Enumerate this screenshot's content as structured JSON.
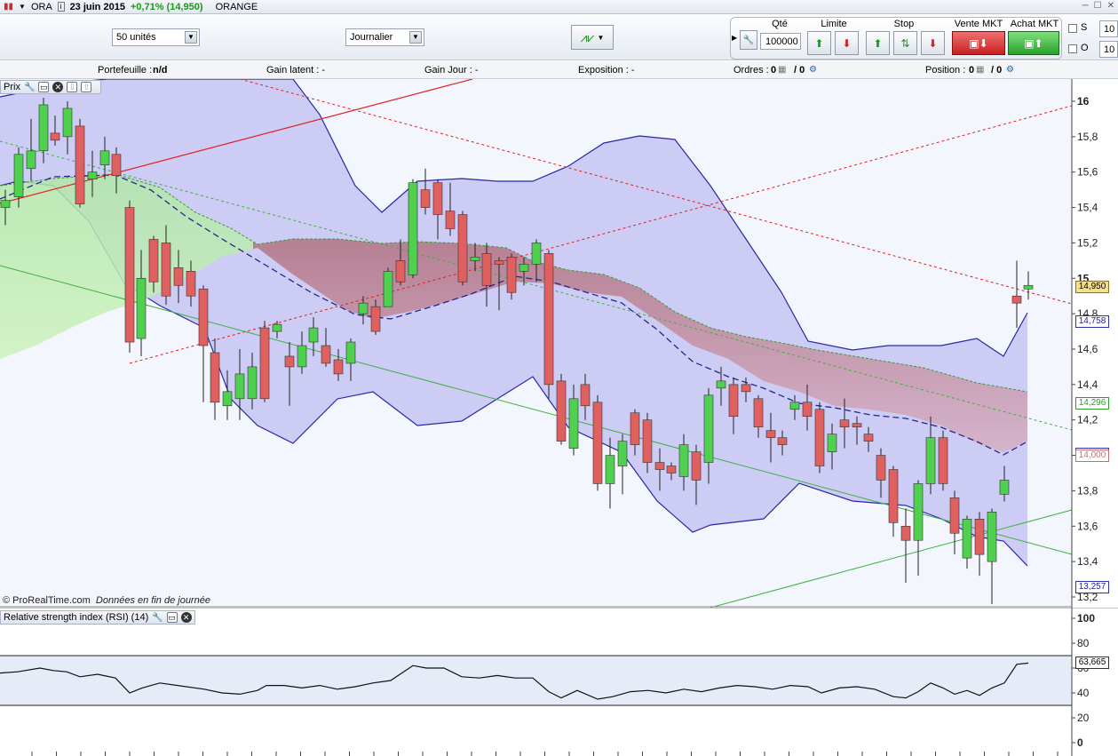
{
  "title": {
    "ticker": "ORA",
    "date": "23 juin 2015",
    "change": "+0,71% (14,950)",
    "name": "ORANGE"
  },
  "toolbar": {
    "quantity_select": "50 unités",
    "period_select": "Journalier",
    "qty_label": "Qté",
    "qty_value": "100000",
    "limit_label": "Limite",
    "stop_label": "Stop",
    "sell_label": "Vente MKT",
    "buy_label": "Achat MKT",
    "s_label": "S",
    "o_label": "O",
    "s_value": "10",
    "o_value": "10"
  },
  "infobar": {
    "portfolio_label": "Portefeuille :",
    "portfolio_value": "n/d",
    "gain_latent": "Gain latent :  -",
    "gain_jour": "Gain Jour :  -",
    "exposition": "Exposition :  -",
    "ordres_label": "Ordres :",
    "ordres_a": "0",
    "ordres_b": "/ 0",
    "position_label": "Position :",
    "position_a": "0",
    "position_b": "/ 0"
  },
  "price_panel": {
    "title": "Prix",
    "copyright": "© ProRealTime.com",
    "copyright_note": "Données en fin de journée",
    "y_ticks": [
      "16",
      "15,8",
      "15,6",
      "15,4",
      "15,2",
      "15",
      "14,8",
      "14,6",
      "14,4",
      "14,2",
      "14",
      "13,8",
      "13,6",
      "13,4",
      "13,2"
    ],
    "tags": [
      {
        "text": "14,950",
        "bg": "#f5e08a",
        "border": "#8a7020",
        "color": "#000"
      },
      {
        "text": "14,758",
        "bg": "#ffffff",
        "border": "#3030aa",
        "color": "#2020a0"
      },
      {
        "text": "14,296",
        "bg": "#ffffff",
        "border": "#2f9a2f",
        "color": "#2f9a2f"
      },
      {
        "text": "14,008",
        "bg": "#ffffff",
        "border": "#3030aa",
        "color": "#2020a0"
      },
      {
        "text": "14,000",
        "bg": "#ffffff",
        "border": "#c07070",
        "color": "#c07070"
      },
      {
        "text": "13,257",
        "bg": "#ffffff",
        "border": "#3030aa",
        "color": "#2020a0"
      }
    ]
  },
  "rsi_panel": {
    "title": "Relative strength index (RSI) (14)",
    "y_ticks": [
      "100",
      "80",
      "60",
      "40",
      "20",
      "0"
    ],
    "value_tag": "63,665"
  },
  "colors": {
    "up": "#4fd04f",
    "down": "#e06060",
    "band_fill": "#c8c8f4",
    "band_line": "#2828a8"
  }
}
